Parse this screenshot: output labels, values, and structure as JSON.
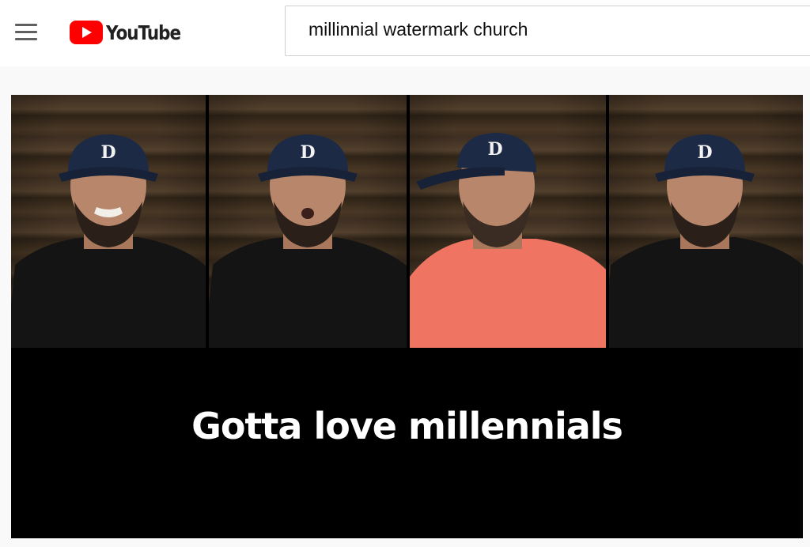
{
  "header": {
    "menu_icon": "hamburger-menu-icon",
    "logo_text": "YouTube",
    "logo_icon": "youtube-play-icon",
    "brand_color": "#ff0000"
  },
  "search": {
    "value": "millinnial watermark church"
  },
  "video": {
    "caption": "Gotta love millennials",
    "panels": [
      {
        "cap_letter": "D",
        "shirt_color": "#141414"
      },
      {
        "cap_letter": "D",
        "shirt_color": "#141414"
      },
      {
        "cap_letter": "D",
        "shirt_color": "#ef7562"
      },
      {
        "cap_letter": "D",
        "shirt_color": "#141414"
      }
    ]
  }
}
